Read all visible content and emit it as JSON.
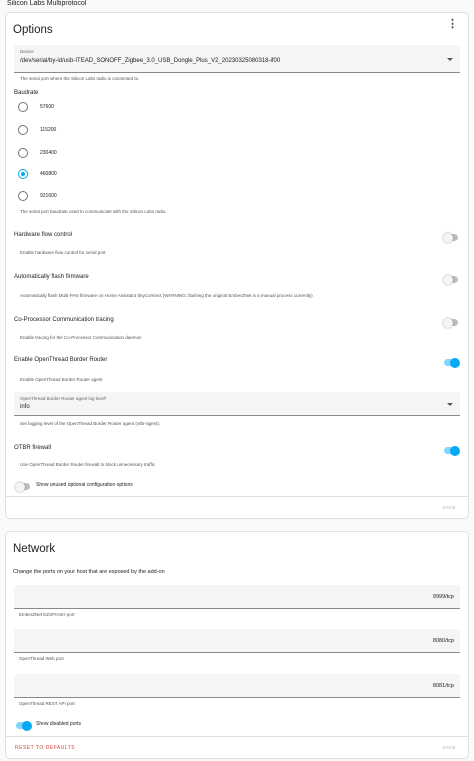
{
  "page": {
    "title": "Silicon Labs Multiprotocol"
  },
  "options": {
    "title": "Options",
    "device": {
      "label": "Device",
      "value": "/dev/serial/by-id/usb-ITEAD_SONOFF_Zigbee_3.0_USB_Dongle_Plus_V2_20230325080318-if00",
      "helper": "The serial port where the Silicon Labs radio is connected to."
    },
    "baudrate": {
      "label": "Baudrate",
      "options": [
        "57600",
        "115200",
        "230400",
        "460800",
        "921600"
      ],
      "selected": "460800",
      "helper": "The serial port baudrate used to communicate with the Silicon Labs radio."
    },
    "hardware_flow": {
      "label": "Hardware flow control",
      "helper": "Enable hardware flow control for serial port",
      "on": false
    },
    "auto_flash": {
      "label": "Automatically flash firmware",
      "helper": "Automatically flash Multi-PAN firmware on Home Assistant SkyConnect (WARNING: flashing the original EmberZNet is a manual process currently)",
      "on": false
    },
    "cpc_tracing": {
      "label": "Co-Processor Communication tracing",
      "helper": "Enable tracing for the Co-Processor Communication daemon",
      "on": false
    },
    "otbr": {
      "label": "Enable OpenThread Border Router",
      "helper": "Enable OpenThread Border Router agent",
      "on": true
    },
    "otbr_log": {
      "label": "OpenThread Border Router agent log level*",
      "value": "info",
      "helper": "Set logging level of the OpenThread Border Router agent (otbr-agent)."
    },
    "otbr_firewall": {
      "label": "OTBR firewall",
      "helper": "Use OpenThread Border Router firewall to block unnecessary traffic",
      "on": true
    },
    "show_unused": {
      "label": "Show unused optional configuration options",
      "on": false
    },
    "save_label": "SAVE"
  },
  "network": {
    "title": "Network",
    "description": "Change the ports on your host that are exposed by the add-on",
    "ports": [
      {
        "value": "9999/tcp",
        "helper": "EmberZNet EZSP/ASH port"
      },
      {
        "value": "8080/tcp",
        "helper": "OpenThread Web port"
      },
      {
        "value": "8081/tcp",
        "helper": "OpenThread REST API port"
      }
    ],
    "show_disabled": {
      "label": "Show disabled ports",
      "on": true
    },
    "reset_label": "RESET TO DEFAULTS",
    "save_label": "SAVE"
  },
  "colors": {
    "accent": "#03a9f4",
    "danger": "#db4437"
  }
}
